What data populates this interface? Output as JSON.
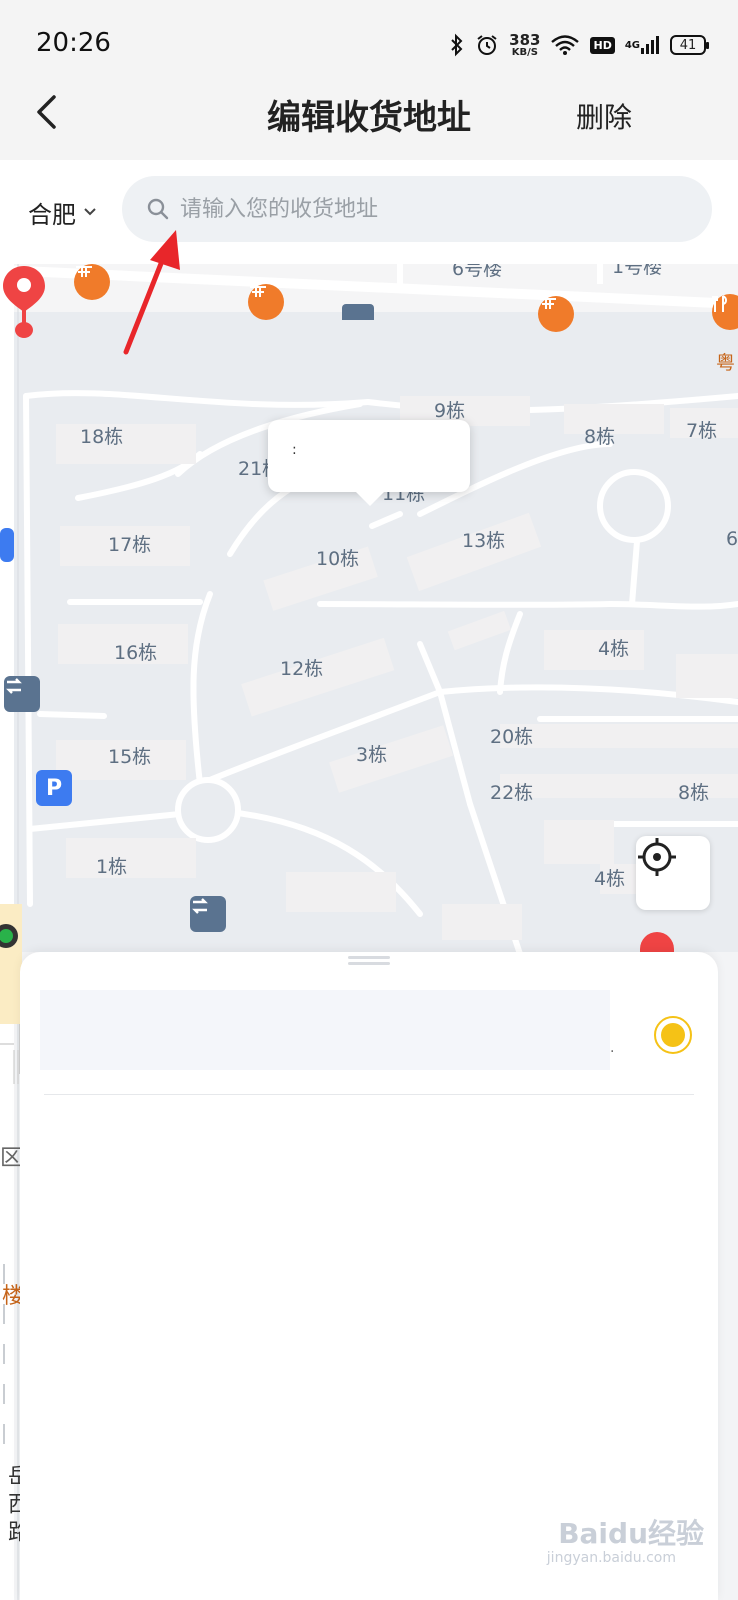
{
  "status_bar": {
    "time": "20:26",
    "net_speed": "383",
    "net_unit": "KB/S",
    "hd": "HD",
    "signal": "4G",
    "battery": "41"
  },
  "header": {
    "title": "编辑收货地址",
    "delete_label": "删除"
  },
  "search": {
    "city": "合肥",
    "placeholder": "请输入您的收货地址"
  },
  "map": {
    "labels": [
      "6号楼",
      "1号楼",
      "9栋",
      "18栋",
      "8栋",
      "7栋",
      "21栋",
      "11栋",
      "13栋",
      "17栋",
      "10栋",
      "16栋",
      "12栋",
      "4栋",
      "20栋",
      "15栋",
      "3栋",
      "22栋",
      "8栋",
      "1栋",
      "4栋",
      "6"
    ],
    "side_labels": {
      "district": "区",
      "building": "楼",
      "poi_text": "粤",
      "street": "岳西路"
    },
    "bubble_text": ":",
    "poi_parking": "P"
  },
  "sheet": {
    "address_suffix": "."
  },
  "watermark": {
    "brand": "Baidu经验",
    "url": "jingyan.baidu.com"
  },
  "colors": {
    "accent": "#f5c216",
    "pin": "#ef4444",
    "poi_orange": "#f07b2a",
    "annotation_arrow": "#e8262a"
  }
}
